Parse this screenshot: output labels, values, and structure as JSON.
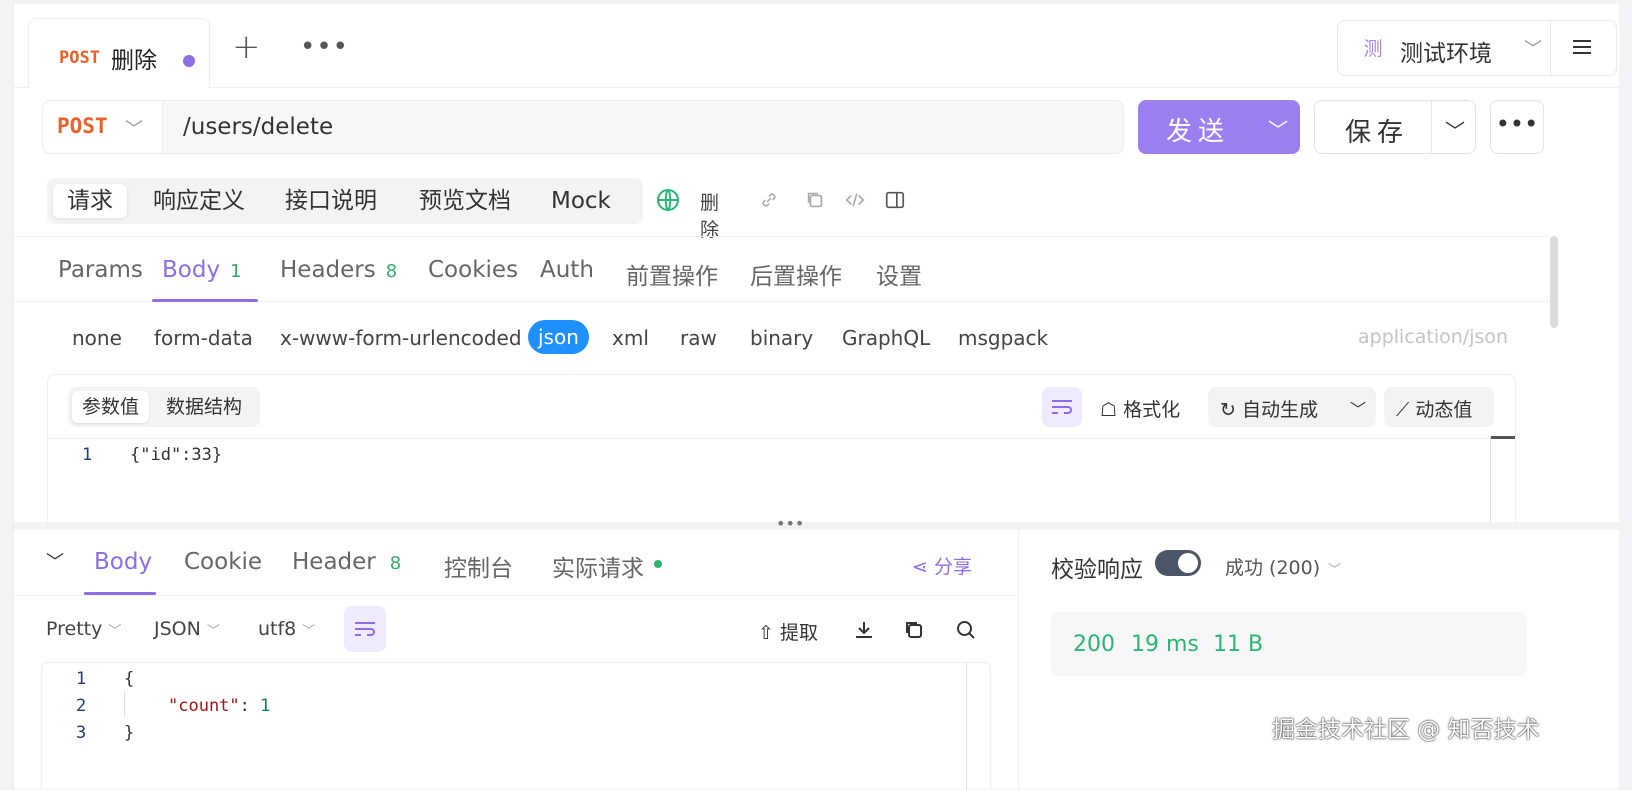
{
  "tab": {
    "method": "POST",
    "name": "删除"
  },
  "env": {
    "badge": "测",
    "label": "测试环境"
  },
  "url": {
    "method": "POST",
    "path": "/users/delete"
  },
  "buttons": {
    "send": "发送",
    "save": "保存"
  },
  "seg_tabs": [
    "请求",
    "响应定义",
    "接口说明",
    "预览文档",
    "Mock"
  ],
  "seg_extra": {
    "label": "删除"
  },
  "req_tabs": [
    {
      "label": "Params"
    },
    {
      "label": "Body",
      "count": "1"
    },
    {
      "label": "Headers",
      "count": "8"
    },
    {
      "label": "Cookies"
    },
    {
      "label": "Auth"
    },
    {
      "label": "前置操作"
    },
    {
      "label": "后置操作"
    },
    {
      "label": "设置"
    }
  ],
  "body_types": [
    "none",
    "form-data",
    "x-www-form-urlencoded",
    "json",
    "xml",
    "raw",
    "binary",
    "GraphQL",
    "msgpack"
  ],
  "content_type": "application/json",
  "editor": {
    "view_tabs": [
      "参数值",
      "数据结构"
    ],
    "format": "格式化",
    "auto_gen": "自动生成",
    "dynamic": "动态值",
    "line": "1",
    "code": "{\"id\":33}"
  },
  "response": {
    "tabs": [
      {
        "label": "Body"
      },
      {
        "label": "Cookie"
      },
      {
        "label": "Header",
        "count": "8"
      },
      {
        "label": "控制台"
      },
      {
        "label": "实际请求"
      }
    ],
    "share": "分享",
    "pretty": "Pretty",
    "format": "JSON",
    "encoding": "utf8",
    "extract": "提取",
    "lines": [
      "1",
      "2",
      "3"
    ],
    "code": {
      "open": "{",
      "key": "\"count\"",
      "value": "1",
      "close": "}"
    }
  },
  "validate": {
    "title": "校验响应",
    "status": "成功 (200)",
    "code": "200",
    "time": "19 ms",
    "size": "11 B"
  },
  "watermark": "掘金技术社区 @ 知否技术",
  "colors": {
    "accent": "#9b7ff0",
    "method": "#e8622a",
    "success": "#2bb673",
    "json_active": "#1e90ff"
  }
}
